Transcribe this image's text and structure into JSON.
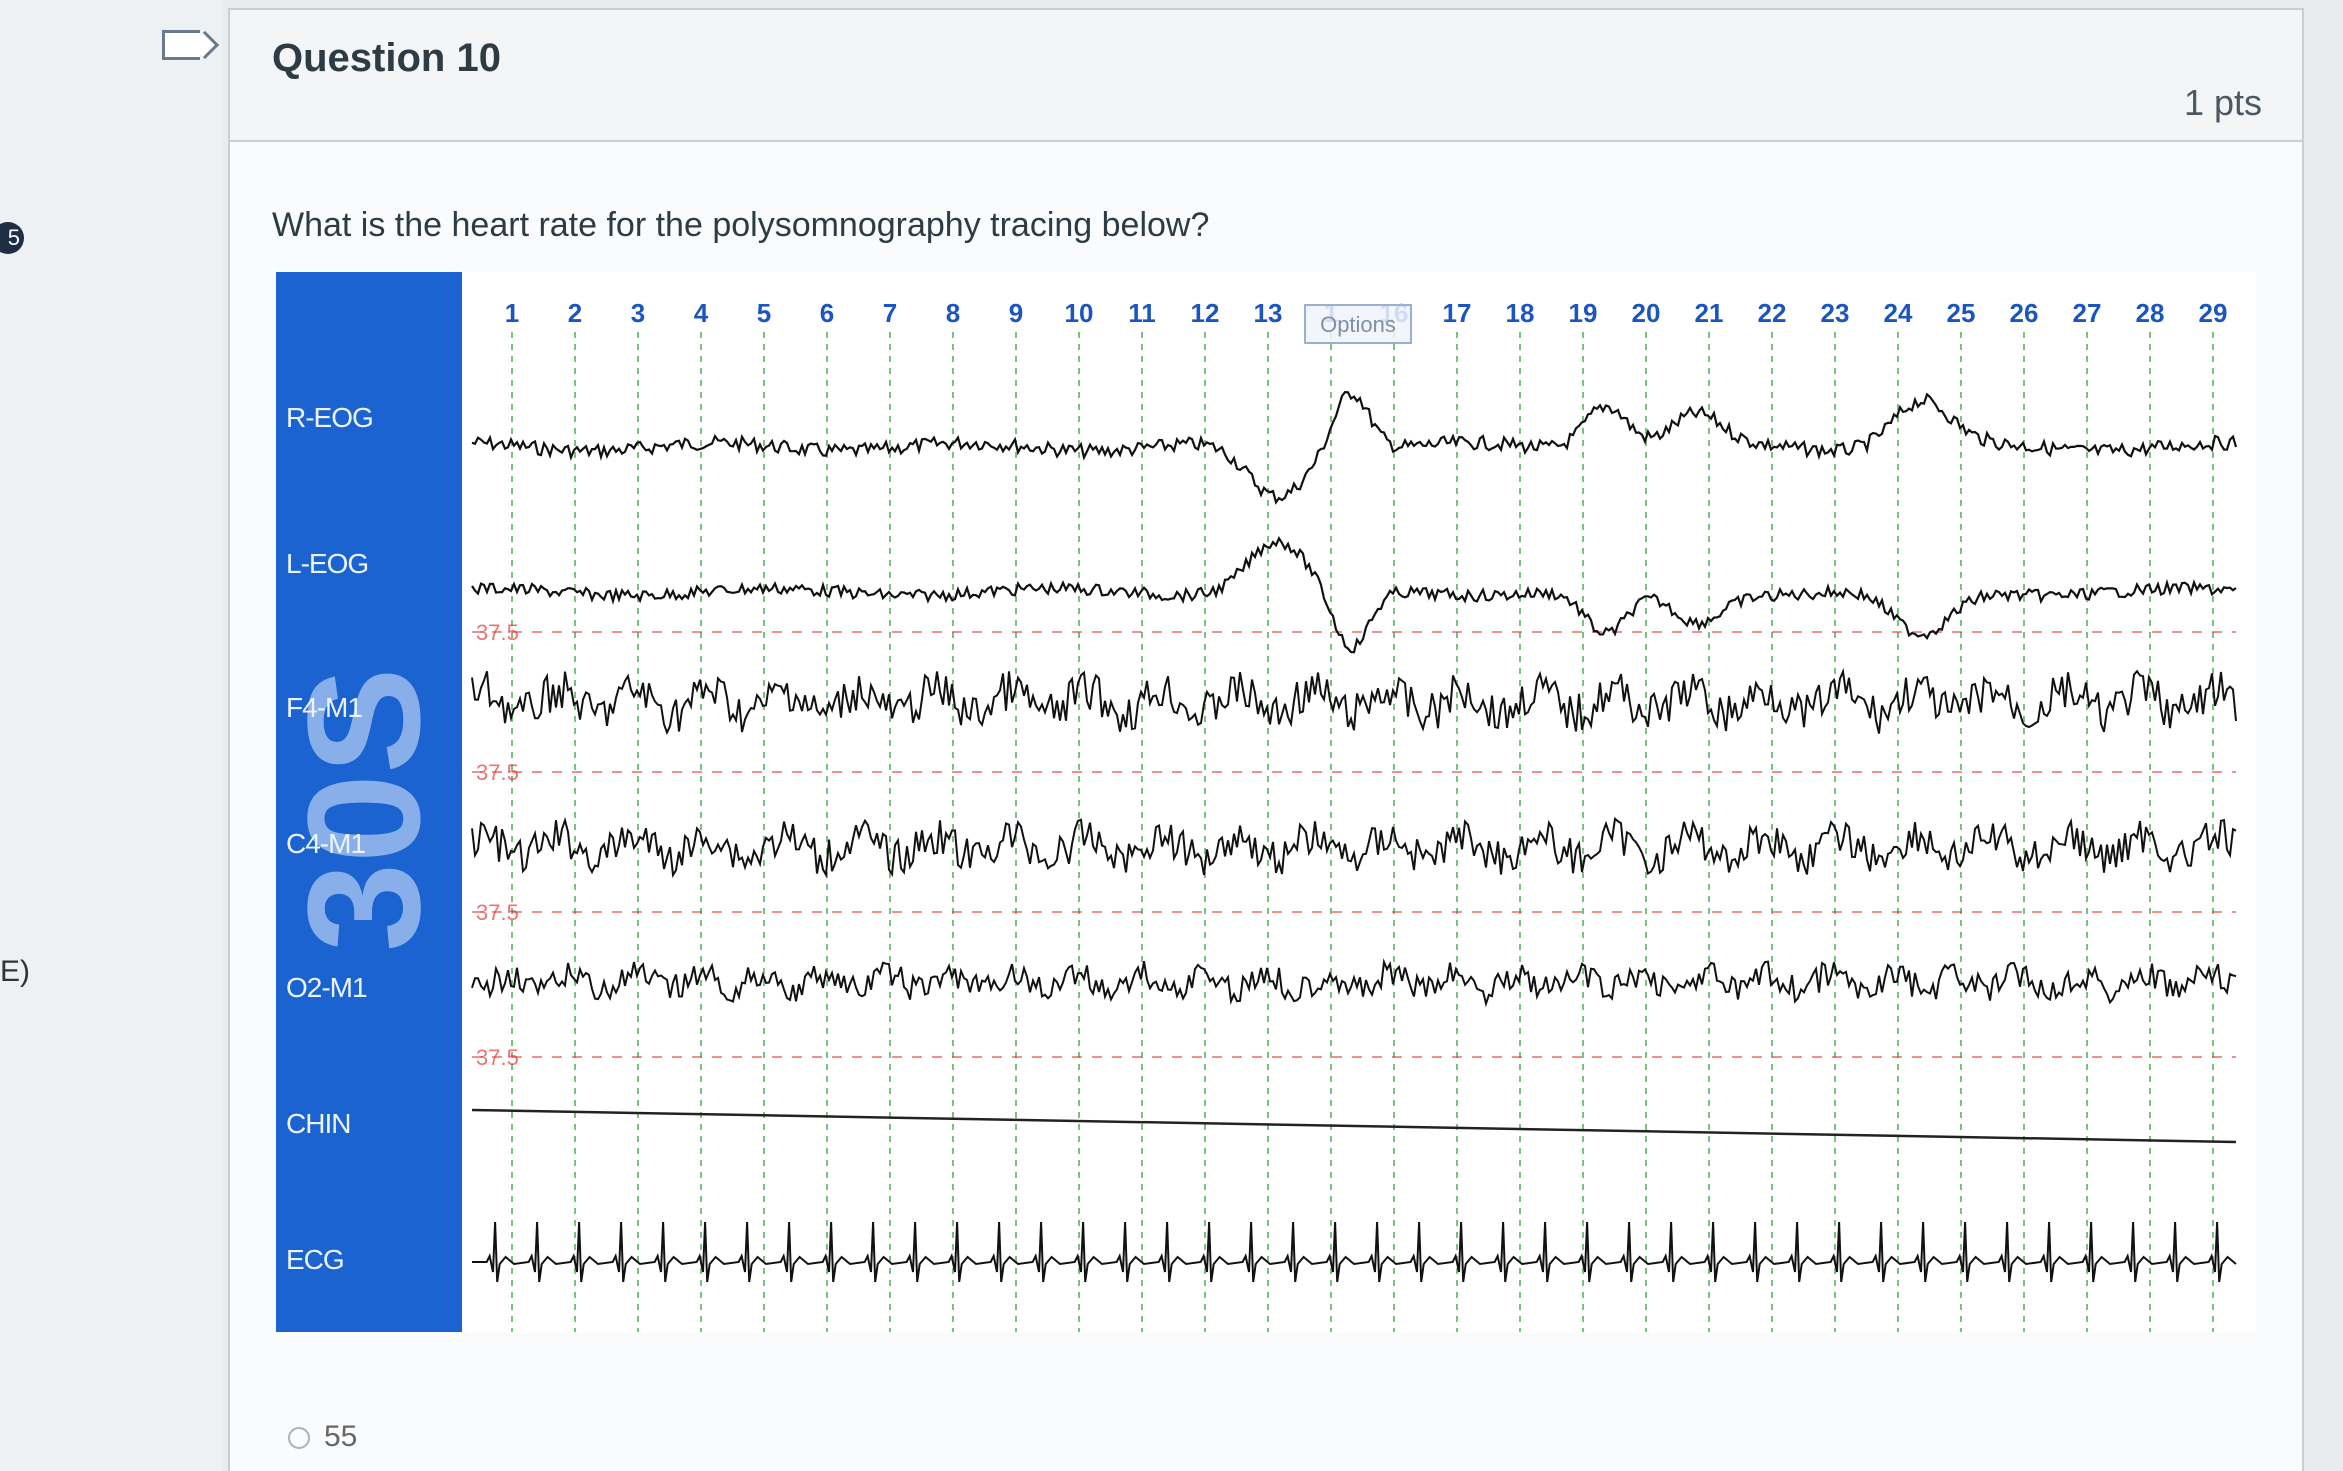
{
  "side": {
    "badge": "5",
    "letter": "E)"
  },
  "question": {
    "title": "Question 10",
    "points": "1 pts",
    "text": "What is the heart rate for the polysomnography tracing below?"
  },
  "tracing": {
    "epoch_length": "30S",
    "options_label": "Options",
    "second_markers": [
      "1",
      "2",
      "3",
      "4",
      "5",
      "6",
      "7",
      "8",
      "9",
      "10",
      "11",
      "12",
      "13",
      "1",
      "16",
      "17",
      "18",
      "19",
      "20",
      "21",
      "22",
      "23",
      "24",
      "25",
      "26",
      "27",
      "28",
      "29"
    ],
    "channels": [
      "R-EOG",
      "L-EOG",
      "F4-M1",
      "C4-M1",
      "O2-M1",
      "CHIN",
      "ECG"
    ],
    "scale_labels": [
      "37.5",
      "37.5",
      "37.5",
      "37.5"
    ],
    "panel_color": "#1a63d0",
    "grid_color": "#4caf50",
    "reference_line_color": "#e53935"
  },
  "answer_options": [
    "55"
  ]
}
